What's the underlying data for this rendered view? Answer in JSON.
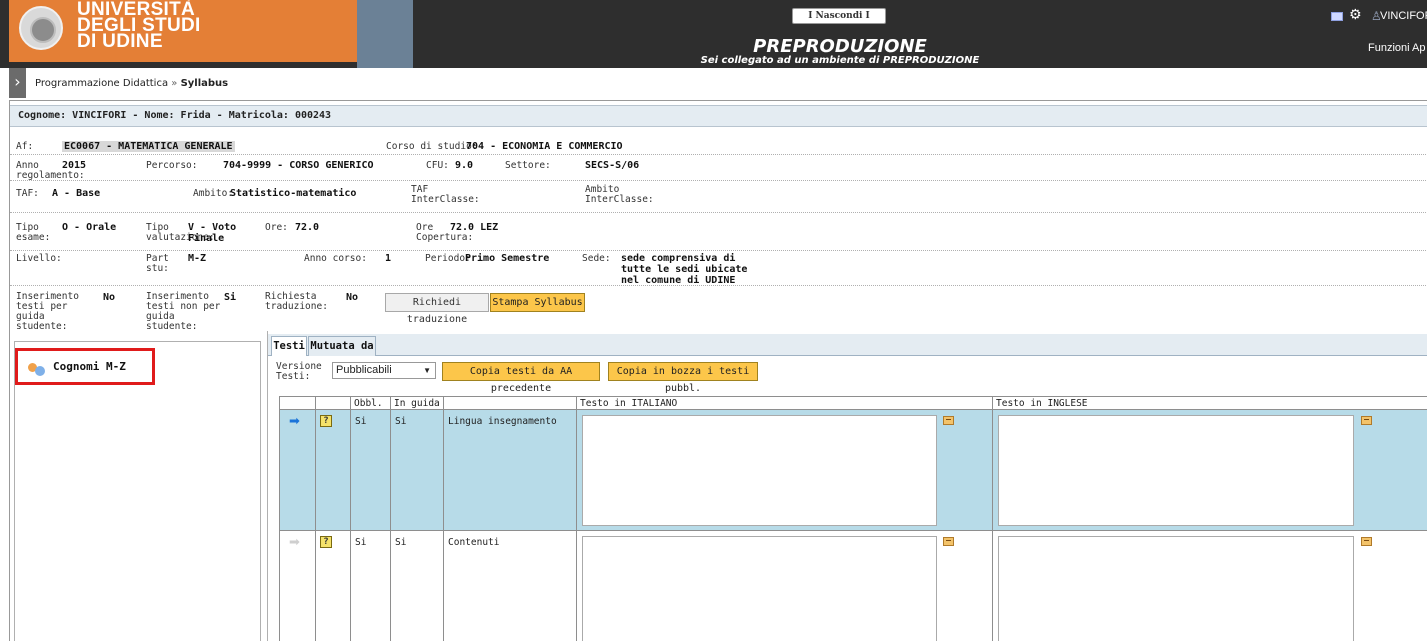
{
  "header": {
    "brand_lines": [
      "UNIVERSITÀ",
      "DEGLI STUDI",
      "DI UDINE"
    ],
    "hide_button": "I Nascondi I",
    "env_title": "PREPRODUZIONE",
    "env_subtitle": "Sei collegato ad un ambiente di PREPRODUZIONE",
    "user_name": "VINCIFORI F",
    "functions_label": "Funzioni Ap"
  },
  "breadcrumb": {
    "parent": "Programmazione Didattica",
    "separator": "»",
    "current": "Syllabus"
  },
  "student": {
    "bar": "Cognome: VINCIFORI - Nome: Frida - Matricola: 000243"
  },
  "info": {
    "af_label": "Af:",
    "af_value": "EC0067 - MATEMATICA GENERALE",
    "corso_label": "Corso di studio:",
    "corso_value": "704 - ECONOMIA E COMMERCIO",
    "anno_label": "Anno regolamento:",
    "anno_value": "2015",
    "percorso_label": "Percorso:",
    "percorso_value": "704-9999 - CORSO GENERICO",
    "cfu_label": "CFU:",
    "cfu_value": "9.0",
    "settore_label": "Settore:",
    "settore_value": "SECS-S/06",
    "taf_label": "TAF:",
    "taf_value": "A - Base",
    "ambito_label": "Ambito:",
    "ambito_value": "Statistico-matematico",
    "taf_inter_label": "TAF InterClasse:",
    "ambito_inter_label": "Ambito InterClasse:",
    "tipo_esame_label": "Tipo esame:",
    "tipo_esame_value": "O - Orale",
    "tipo_val_label": "Tipo valutazione:",
    "tipo_val_value": "V - Voto Finale",
    "ore_label": "Ore:",
    "ore_value": "72.0",
    "ore_cop_label": "Ore Copertura:",
    "ore_cop_value": "72.0 LEZ",
    "livello_label": "Livello:",
    "part_label": "Part stu:",
    "part_value": "M-Z",
    "anno_corso_label": "Anno corso:",
    "anno_corso_value": "1",
    "periodo_label": "Periodo:",
    "periodo_value": "Primo Semestre",
    "sede_label": "Sede:",
    "sede_value": "sede comprensiva di tutte le sedi ubicate nel comune di UDINE",
    "ins_guida_label": "Inserimento testi per guida studente:",
    "ins_guida_value": "No",
    "ins_non_guida_label": "Inserimento testi non per guida studente:",
    "ins_non_guida_value": "Si",
    "rich_trad_label": "Richiesta traduzione:",
    "rich_trad_value": "No"
  },
  "actions": {
    "richiedi_traduzione": "Richiedi traduzione",
    "stampa_syllabus": "Stampa Syllabus",
    "copia_aa": "Copia testi da AA precedente",
    "copia_bozza": "Copia in bozza i testi pubbl."
  },
  "left_panel": {
    "group_label": "Cognomi M-Z"
  },
  "tabs": [
    {
      "label": "Testi",
      "active": true
    },
    {
      "label": "Mutuata da",
      "active": false
    }
  ],
  "versione": {
    "label": "Versione Testi:",
    "selected": "Pubblicabili"
  },
  "grid": {
    "headers": {
      "obbl": "Obbl.",
      "in_guida": "In guida",
      "name": "",
      "it": "Testo in ITALIANO",
      "en": "Testo in INGLESE"
    },
    "rows": [
      {
        "obbl": "Si",
        "in_guida": "Si",
        "name": "Lingua insegnamento",
        "selected": true
      },
      {
        "obbl": "Si",
        "in_guida": "Si",
        "name": "Contenuti",
        "selected": false
      }
    ]
  },
  "colors": {
    "header_bg": "#2e2e2e",
    "brand_orange": "#e47f36",
    "brand_blue": "#6b8196",
    "row_selected": "#b7dbe8",
    "action_yellow": "#fcc64a",
    "highlight_red": "#e01b1b"
  },
  "icons": {
    "mail": "mail-icon",
    "gear": "gear-icon",
    "user": "user-icon",
    "group": "group-icon",
    "help": "help-icon",
    "edit": "edit-icon",
    "row_arrow": "arrow-right-icon"
  }
}
